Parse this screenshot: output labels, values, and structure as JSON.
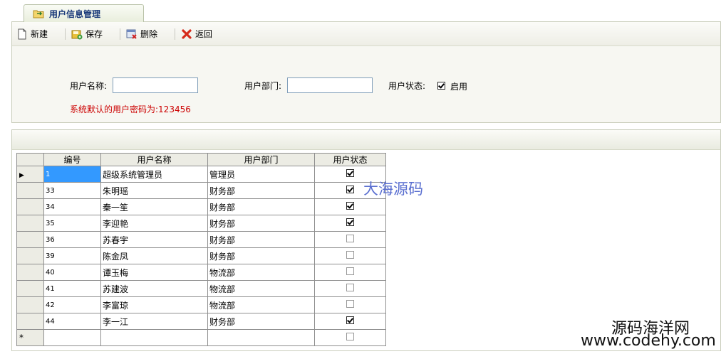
{
  "tab": {
    "title": "用户信息管理"
  },
  "toolbar": {
    "new_label": "新建",
    "save_label": "保存",
    "delete_label": "删除",
    "back_label": "返回"
  },
  "form": {
    "username_label": "用户名称:",
    "username_value": "",
    "dept_label": "用户部门:",
    "dept_value": "",
    "status_label": "用户状态:",
    "enabled_label": "启用",
    "enabled_checked": true,
    "note": "系统默认的用户密码为:123456"
  },
  "grid": {
    "columns": [
      "编号",
      "用户名称",
      "用户部门",
      "用户状态"
    ],
    "rows": [
      {
        "id": "1",
        "name": "超级系统管理员",
        "dept": "管理员",
        "status": true
      },
      {
        "id": "33",
        "name": "朱明瑶",
        "dept": "财务部",
        "status": true
      },
      {
        "id": "34",
        "name": "秦一笙",
        "dept": "财务部",
        "status": true
      },
      {
        "id": "35",
        "name": "李迎艳",
        "dept": "财务部",
        "status": true
      },
      {
        "id": "36",
        "name": "苏春宇",
        "dept": "财务部",
        "status": false
      },
      {
        "id": "39",
        "name": "陈金凤",
        "dept": "财务部",
        "status": false
      },
      {
        "id": "40",
        "name": "谭玉梅",
        "dept": "物流部",
        "status": false
      },
      {
        "id": "41",
        "name": "苏建波",
        "dept": "物流部",
        "status": false
      },
      {
        "id": "42",
        "name": "李富琼",
        "dept": "物流部",
        "status": false
      },
      {
        "id": "44",
        "name": "李一江",
        "dept": "财务部",
        "status": true
      }
    ],
    "current_row_marker": "▶",
    "new_row_marker": "*"
  },
  "watermarks": {
    "center": "大海源码",
    "bottom_title": "源码海洋网",
    "bottom_url": "www.codehy.com"
  },
  "colors": {
    "note": "#cc0000",
    "selection": "#3399ff",
    "tab_title": "#1a3a7a"
  }
}
